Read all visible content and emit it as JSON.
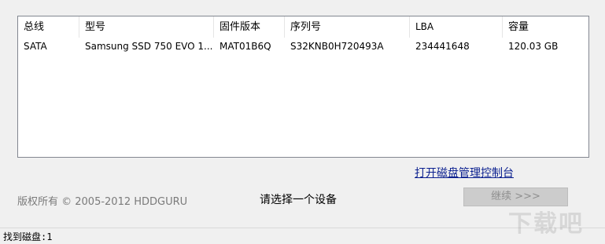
{
  "table": {
    "columns": [
      "总线",
      "型号",
      "固件版本",
      "序列号",
      "LBA",
      "容量"
    ],
    "rows": [
      [
        "SATA",
        "Samsung SSD 750 EVO 1...",
        "MAT01B6Q",
        "S32KNB0H720493A",
        "234441648",
        "120.03 GB"
      ]
    ]
  },
  "link_label": "打开磁盘管理控制台",
  "copyright": "版权所有 © 2005-2012 HDDGURU",
  "prompt": "请选择一个设备",
  "next_button": "继续 >>>",
  "status": "找到磁盘:1",
  "watermark": "下载吧"
}
